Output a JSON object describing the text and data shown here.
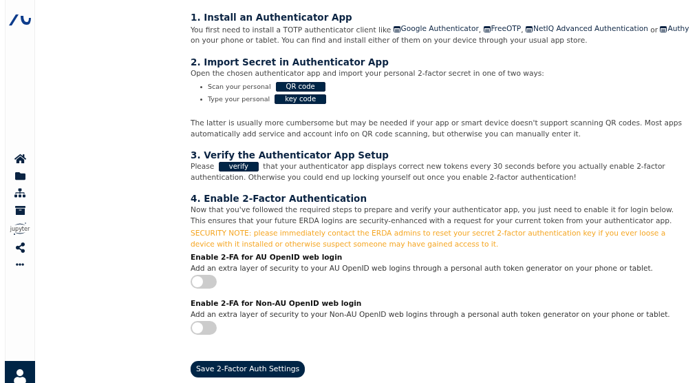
{
  "sidebar": {
    "items": [
      {
        "kind": "home"
      },
      {
        "kind": "folder"
      },
      {
        "kind": "network"
      },
      {
        "kind": "archive"
      },
      {
        "kind": "jupyter",
        "label": "jupyter"
      },
      {
        "kind": "share"
      },
      {
        "kind": "more"
      }
    ]
  },
  "steps": [
    {
      "title": "1. Install an Authenticator App",
      "paragraphs": [
        [
          {
            "kind": "text",
            "text": "You first need to install a TOTP authenticator client like "
          },
          {
            "kind": "link",
            "text": "Google Authenticator"
          },
          {
            "kind": "text",
            "text": ", "
          },
          {
            "kind": "link",
            "text": "FreeOTP"
          },
          {
            "kind": "text",
            "text": ", "
          },
          {
            "kind": "link",
            "text": "NetIQ Advanced Authentication"
          },
          {
            "kind": "text",
            "text": " or "
          },
          {
            "kind": "link",
            "text": "Authy"
          },
          {
            "kind": "text",
            "text": " on your phone or tablet. You can find and install either of them on your device through your usual app store."
          }
        ]
      ]
    },
    {
      "title": "2. Import Secret in Authenticator App",
      "paragraphs": [
        [
          {
            "kind": "text",
            "text": "Open the chosen authenticator app and import your personal 2-factor secret in one of two ways:"
          }
        ]
      ],
      "bullets": [
        {
          "text": "Scan your personal",
          "button": "QR code"
        },
        {
          "text": "Type your personal",
          "button": "key code"
        }
      ],
      "after": [
        [
          {
            "kind": "text",
            "text": "The latter is usually more cumbersome but may be needed if your app or smart device doesn't support scanning QR codes. Most apps automatically add service and account info on QR code scanning, but otherwise you can manually enter it."
          }
        ]
      ]
    },
    {
      "title": "3. Verify the Authenticator App Setup",
      "paragraphs": [
        [
          {
            "kind": "text",
            "text": "Please "
          },
          {
            "kind": "button",
            "text": "verify"
          },
          {
            "kind": "text",
            "text": " that your authenticator app displays correct new tokens every 30 seconds before you actually enable 2-factor authentication. Otherwise you could end up locking yourself out once you enable 2-factor authentication!"
          }
        ]
      ]
    },
    {
      "title": "4. Enable 2-Factor Authentication",
      "paragraphs": [
        [
          {
            "kind": "text",
            "text": "Now that you've followed the required steps to prepare and verify your authenticator app, you just need to enable it for login below. This ensures that your future ERDA logins are security-enhanced with a request for your current token from your authenticator app."
          }
        ]
      ],
      "note": "SECURITY NOTE: please immediately contact the ERDA admins to reset your secret 2-factor authentication key if you ever loose a device with it installed or otherwise suspect someone may have gained access to it."
    }
  ],
  "settings": [
    {
      "title": "Enable 2-FA for AU OpenID web login",
      "description": "Add an extra layer of security to your AU OpenID web logins through a personal auth token generator on your phone or tablet.",
      "on": false
    },
    {
      "title": "Enable 2-FA for Non-AU OpenID web login",
      "description": "Add an extra layer of security to your Non-AU OpenID web logins through a personal auth token generator on your phone or tablet.",
      "on": false
    }
  ],
  "save_button": "Save 2-Factor Auth Settings"
}
